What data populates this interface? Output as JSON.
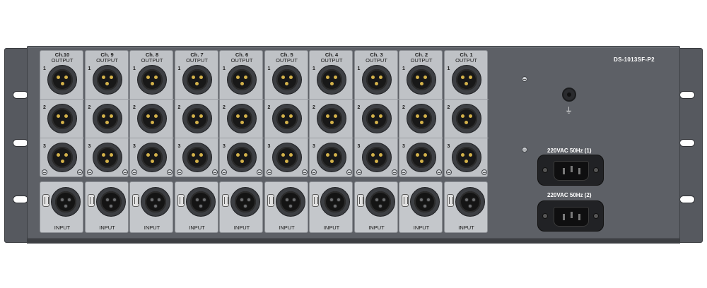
{
  "device": {
    "model": "DS-1013SF-P2",
    "output_label": "OUTPUT",
    "input_label": "INPUT",
    "ground_symbol": "⏚",
    "power_inlets": [
      {
        "label": "220VAC 50Hz (1)"
      },
      {
        "label": "220VAC 50Hz (2)"
      }
    ]
  },
  "channels": [
    {
      "label": "Ch.10",
      "ports": [
        "1",
        "2",
        "3"
      ]
    },
    {
      "label": "Ch. 9",
      "ports": [
        "1",
        "2",
        "3"
      ]
    },
    {
      "label": "Ch. 8",
      "ports": [
        "1",
        "2",
        "3"
      ]
    },
    {
      "label": "Ch. 7",
      "ports": [
        "1",
        "2",
        "3"
      ]
    },
    {
      "label": "Ch. 6",
      "ports": [
        "1",
        "2",
        "3"
      ]
    },
    {
      "label": "Ch. 5",
      "ports": [
        "1",
        "2",
        "3"
      ]
    },
    {
      "label": "Ch. 4",
      "ports": [
        "1",
        "2",
        "3"
      ]
    },
    {
      "label": "Ch. 3",
      "ports": [
        "1",
        "2",
        "3"
      ]
    },
    {
      "label": "Ch. 2",
      "ports": [
        "1",
        "2",
        "3"
      ]
    },
    {
      "label": "Ch. 1",
      "ports": [
        "1",
        "2",
        "3"
      ]
    }
  ],
  "colors": {
    "chassis": "#5d6066",
    "panel": "#bfc2c6",
    "pin_gold": "#d4b24a"
  }
}
